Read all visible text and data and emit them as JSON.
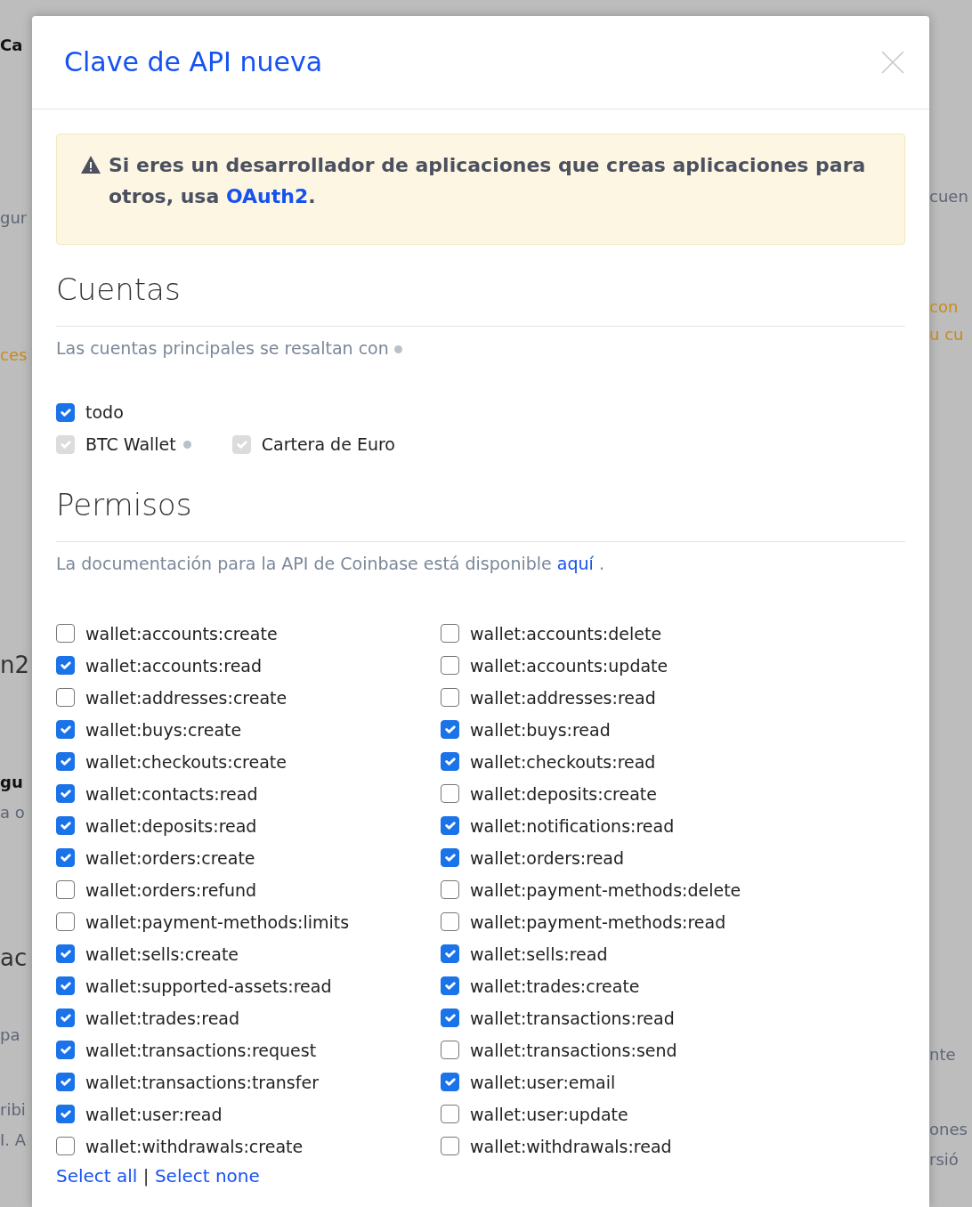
{
  "background": {
    "left": [
      {
        "text": "Ca",
        "kind": "bold"
      },
      {
        "text": "gur",
        "kind": "plain"
      },
      {
        "text": "ces",
        "kind": "orange"
      },
      {
        "text": "n2",
        "kind": "large"
      },
      {
        "text": "gu",
        "kind": "bold"
      },
      {
        "text": "a o",
        "kind": "plain"
      },
      {
        "text": "ac",
        "kind": "large"
      },
      {
        "text": "pa",
        "kind": "plain"
      },
      {
        "text": "ribi",
        "kind": "plain"
      },
      {
        "text": "I. A",
        "kind": "plain"
      }
    ],
    "right": [
      {
        "text": "cuen",
        "kind": "plain"
      },
      {
        "text": "con",
        "kind": "orange"
      },
      {
        "text": "u cu",
        "kind": "orange"
      },
      {
        "text": "nte",
        "kind": "plain"
      },
      {
        "text": "ones",
        "kind": "plain"
      },
      {
        "text": "rsió",
        "kind": "plain"
      }
    ]
  },
  "modal": {
    "title": "Clave de API nueva",
    "alert": {
      "text": "Si eres un desarrollador de aplicaciones que creas aplicaciones para otros, usa ",
      "link": "OAuth2",
      "end": "."
    },
    "accounts": {
      "heading": "Cuentas",
      "note": "Las cuentas principales se resaltan con",
      "items": [
        {
          "label": "todo",
          "kind": "all",
          "checked": true,
          "disabled": false,
          "primary": false
        },
        {
          "label": "BTC Wallet",
          "kind": "account",
          "checked": true,
          "disabled": true,
          "primary": true
        },
        {
          "label": "Cartera de Euro",
          "kind": "account",
          "checked": true,
          "disabled": true,
          "primary": false
        }
      ]
    },
    "permissions": {
      "heading": "Permisos",
      "note": "La documentación para la API de Coinbase está disponible ",
      "link": "aquí",
      "note_end": " .",
      "items": [
        {
          "label": "wallet:accounts:create",
          "checked": false
        },
        {
          "label": "wallet:accounts:delete",
          "checked": false
        },
        {
          "label": "wallet:accounts:read",
          "checked": true
        },
        {
          "label": "wallet:accounts:update",
          "checked": false
        },
        {
          "label": "wallet:addresses:create",
          "checked": false
        },
        {
          "label": "wallet:addresses:read",
          "checked": false
        },
        {
          "label": "wallet:buys:create",
          "checked": true
        },
        {
          "label": "wallet:buys:read",
          "checked": true
        },
        {
          "label": "wallet:checkouts:create",
          "checked": true
        },
        {
          "label": "wallet:checkouts:read",
          "checked": true
        },
        {
          "label": "wallet:contacts:read",
          "checked": true
        },
        {
          "label": "wallet:deposits:create",
          "checked": false
        },
        {
          "label": "wallet:deposits:read",
          "checked": true
        },
        {
          "label": "wallet:notifications:read",
          "checked": true
        },
        {
          "label": "wallet:orders:create",
          "checked": true
        },
        {
          "label": "wallet:orders:read",
          "checked": true
        },
        {
          "label": "wallet:orders:refund",
          "checked": false
        },
        {
          "label": "wallet:payment-methods:delete",
          "checked": false
        },
        {
          "label": "wallet:payment-methods:limits",
          "checked": false
        },
        {
          "label": "wallet:payment-methods:read",
          "checked": false
        },
        {
          "label": "wallet:sells:create",
          "checked": true
        },
        {
          "label": "wallet:sells:read",
          "checked": true
        },
        {
          "label": "wallet:supported-assets:read",
          "checked": true
        },
        {
          "label": "wallet:trades:create",
          "checked": true
        },
        {
          "label": "wallet:trades:read",
          "checked": true
        },
        {
          "label": "wallet:transactions:read",
          "checked": true
        },
        {
          "label": "wallet:transactions:request",
          "checked": true
        },
        {
          "label": "wallet:transactions:send",
          "checked": false
        },
        {
          "label": "wallet:transactions:transfer",
          "checked": true
        },
        {
          "label": "wallet:user:email",
          "checked": true
        },
        {
          "label": "wallet:user:read",
          "checked": true
        },
        {
          "label": "wallet:user:update",
          "checked": false
        },
        {
          "label": "wallet:withdrawals:create",
          "checked": false
        },
        {
          "label": "wallet:withdrawals:read",
          "checked": false
        }
      ],
      "select_all": "Select all",
      "separator": "|",
      "select_none": "Select none"
    }
  }
}
